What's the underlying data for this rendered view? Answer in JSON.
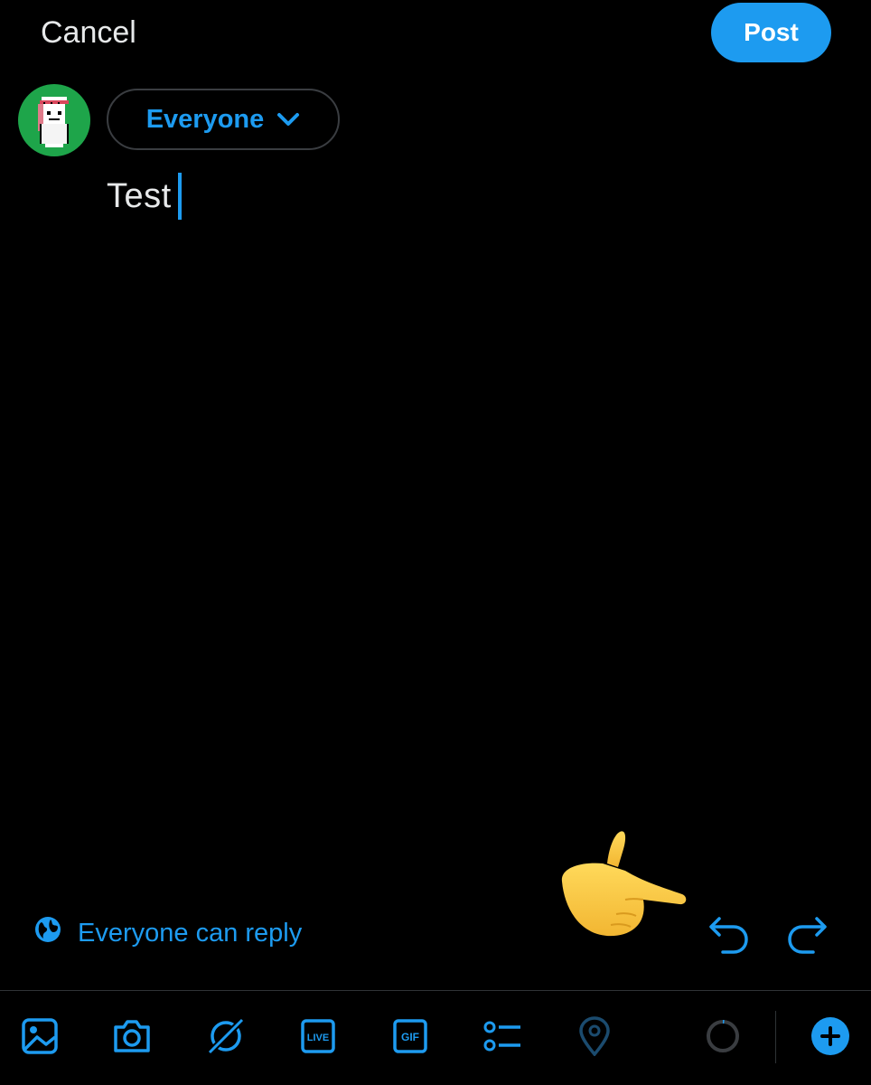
{
  "header": {
    "cancel_label": "Cancel",
    "post_label": "Post"
  },
  "audience": {
    "label": "Everyone",
    "icon": "chevron-down-icon"
  },
  "composer": {
    "text": "Test"
  },
  "reply_setting": {
    "label": "Everyone can reply",
    "icon": "globe-icon"
  },
  "edit_actions": {
    "undo_icon": "undo-icon",
    "redo_icon": "redo-icon"
  },
  "toolbar": {
    "items": [
      "image-icon",
      "camera-icon",
      "grok-icon",
      "live-icon",
      "gif-icon",
      "poll-icon",
      "location-icon",
      "character-count-icon",
      "add-post-icon"
    ],
    "live_text": "LIVE",
    "gif_text": "GIF"
  },
  "colors": {
    "accent": "#1d9bf0",
    "background": "#000000",
    "text": "#e7e9ea",
    "avatar_bg": "#1ea54a"
  }
}
